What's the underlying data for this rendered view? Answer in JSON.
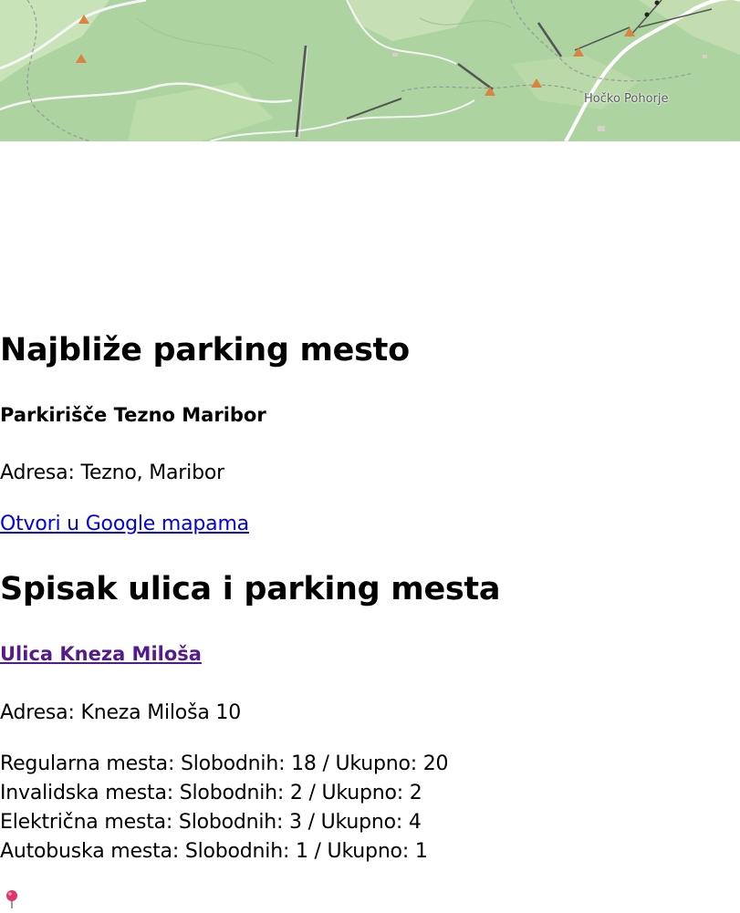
{
  "map": {
    "place_label": "Hočko Pohorje"
  },
  "nearest": {
    "heading": "Najbliže parking mesto",
    "name": "Parkirišče Tezno Maribor",
    "address": "Adresa: Tezno, Maribor",
    "maps_link": "Otvori u Google mapama"
  },
  "list": {
    "heading": "Spisak ulica i parking mesta",
    "streets": [
      {
        "name": "Ulica Kneza Miloša",
        "address": "Adresa: Kneza Miloša 10",
        "spots": [
          "Regularna mesta: Slobodnih: 18 / Ukupno: 20",
          "Invalidska mesta: Slobodnih: 2 / Ukupno: 2",
          "Električna mesta: Slobodnih: 3 / Ukupno: 4",
          "Autobuska mesta: Slobodnih: 1 / Ukupno: 1"
        ]
      }
    ]
  },
  "marker_icon": "pushpin-icon"
}
